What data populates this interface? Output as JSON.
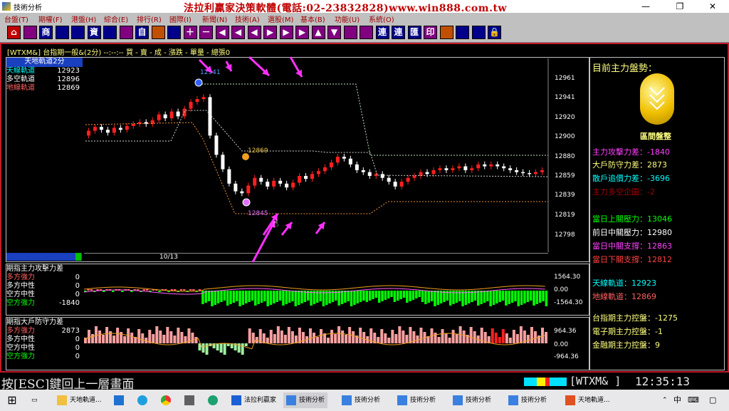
{
  "window": {
    "title": "技術分析",
    "min": "—",
    "max": "❐",
    "close": "✕"
  },
  "menu": [
    "台盤(T)",
    "期權(F)",
    "港盤(H)",
    "綜合(E)",
    "排行(R)",
    "國際(I)",
    "新聞(N)",
    "技術(A)",
    "選股(M)",
    "基本(B)",
    "功能(U)",
    "系統(O)"
  ],
  "marquee": "法拉利贏家決策軟體(電話:02-23832828)www.win888.com.tw",
  "toolbar": {
    "icons": [
      "home-icon",
      "",
      "",
      "",
      "",
      "",
      "",
      "",
      "",
      "",
      "",
      "",
      "",
      "",
      "",
      "",
      "",
      "",
      "",
      "",
      "",
      "",
      "",
      "",
      "",
      "",
      "",
      "",
      "",
      "",
      "",
      "",
      "",
      "",
      ""
    ],
    "labels": [
      "⌂",
      "",
      "商",
      "",
      "",
      "資",
      "",
      "",
      "自",
      "",
      "",
      "＋",
      "－",
      "◀",
      "◀",
      "◀",
      "▶",
      "▶",
      "▶",
      "▲",
      "▼",
      "",
      "",
      "連",
      "連",
      "匯",
      "印",
      "",
      "",
      "",
      "🔒"
    ]
  },
  "chart": {
    "header": "[WTXM&]  台指期一般&(2分)  --:--:--  買 - 賣 - 成 - 漲跌 - 單量 - 總張0",
    "legend_title": "天地軌道2分",
    "legend": [
      {
        "label": "天線軌道",
        "value": "12923",
        "color": "#00ffff"
      },
      {
        "label": "多空軌道",
        "value": "12896",
        "color": "#ffffff"
      },
      {
        "label": "地線軌道",
        "value": "12869",
        "color": "#ff6060"
      }
    ],
    "date_label": "10/13",
    "y_ticks": [
      "12961",
      "12941",
      "12920",
      "12900",
      "12880",
      "12859",
      "12839",
      "12819",
      "12798"
    ],
    "annot_high": "12941",
    "annot_mid": "12869",
    "annot_low": "12845"
  },
  "attack": {
    "title": "期指主力攻擊力差",
    "rows": [
      {
        "label": "多方強力",
        "value": "0",
        "color": "#ff6060"
      },
      {
        "label": "多方中性",
        "value": "0",
        "color": "#ffffff"
      },
      {
        "label": "空方中性",
        "value": "0",
        "color": "#ffffff"
      },
      {
        "label": "空方強力",
        "value": "-1840",
        "color": "#00ff00"
      }
    ],
    "y_ticks": [
      "1564.30",
      "0.00",
      "-1564.30"
    ]
  },
  "retail": {
    "title": "期指大戶防守力差",
    "rows": [
      {
        "label": "多方強力",
        "value": "2873",
        "color": "#ff6060"
      },
      {
        "label": "多方中性",
        "value": "0",
        "color": "#ffffff"
      },
      {
        "label": "空方中性",
        "value": "0",
        "color": "#ffffff"
      },
      {
        "label": "空方強力",
        "value": "0",
        "color": "#00ff00"
      }
    ],
    "y_ticks": [
      "964.36",
      "0.00",
      "-964.36"
    ]
  },
  "info": {
    "title": "目前主力盤勢：",
    "badge": "區間盤整",
    "lines": [
      {
        "text": "主力攻擊力差：-1840",
        "color": "#ff40ff"
      },
      {
        "text": "大戶防守力差：2873",
        "color": "#ffff80"
      },
      {
        "text": "散戶追價力差：-3696",
        "color": "#00ffff"
      },
      {
        "text": "主力多空企圖：-2",
        "color": "#a00000"
      },
      {
        "text": "當日上關壓力：13046",
        "color": "#00ff00"
      },
      {
        "text": "前日中關壓力：12980",
        "color": "#ffffff"
      },
      {
        "text": "當日中關支撐：12863",
        "color": "#ff40ff"
      },
      {
        "text": "當日下關支撐：12812",
        "color": "#ff4040"
      },
      {
        "text": "天線軌道：12923",
        "color": "#00ffff"
      },
      {
        "text": "地線軌道：12869",
        "color": "#ff6060"
      },
      {
        "text": "台指期主力控盤：-1275",
        "color": "#ffff80"
      },
      {
        "text": "電子期主力控盤：-1",
        "color": "#ffff80"
      },
      {
        "text": "金融期主力控盤：9",
        "color": "#ffff80"
      }
    ]
  },
  "status": {
    "esc": "按[ESC]鍵回上一層畫面",
    "symbol": "[WTXM&  ]",
    "clock": "12:35:13"
  },
  "taskbar": {
    "items": [
      "天地軌道...",
      "",
      "",
      "",
      "",
      "",
      "法拉利贏家",
      "技術分析",
      "技術分析",
      "技術分析",
      "技術分析",
      "技術分析",
      "天地軌道..."
    ],
    "tray": [
      "中",
      "⌨"
    ]
  }
}
